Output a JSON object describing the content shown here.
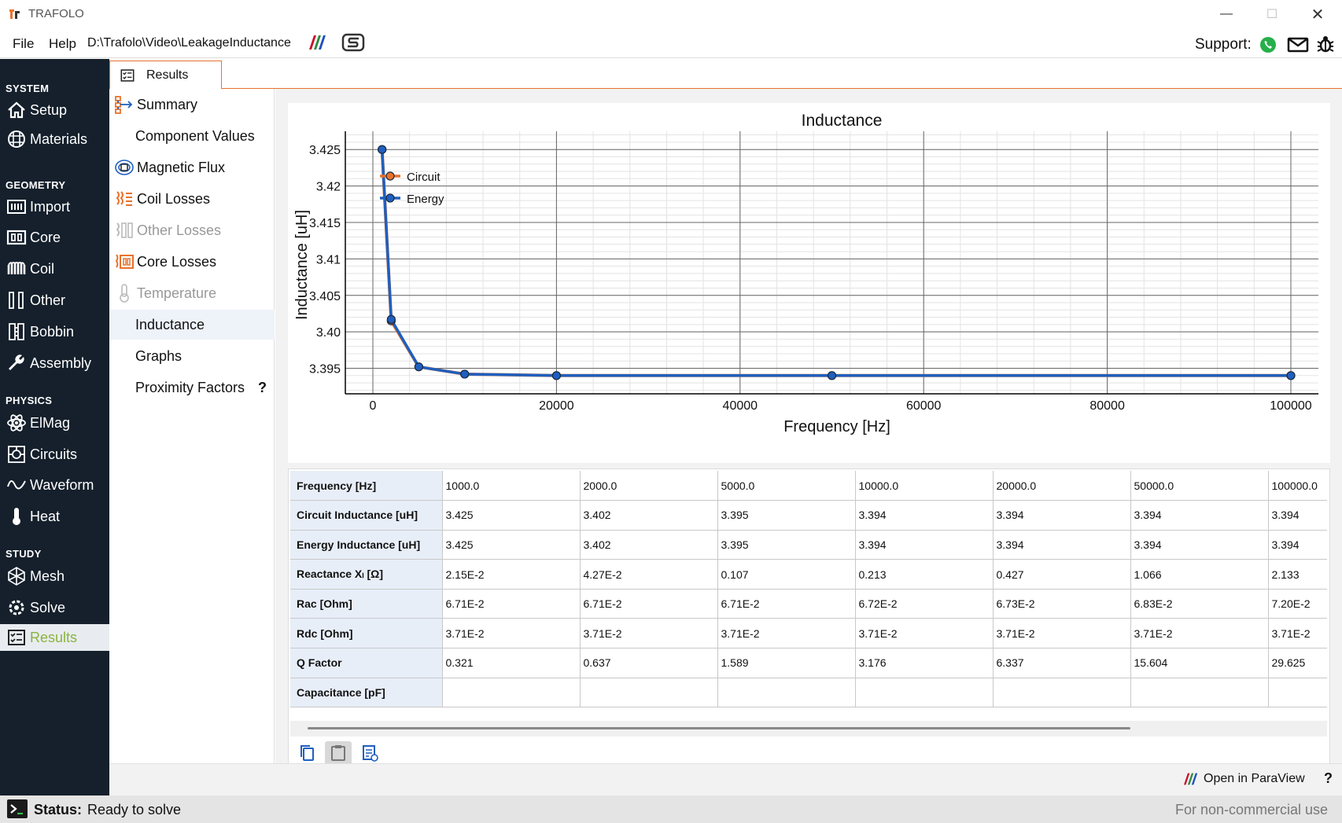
{
  "app": {
    "title": "TRAFOLO",
    "menu": [
      "File",
      "Help"
    ],
    "project_path": "D:\\Trafolo\\Video\\LeakageInductance",
    "support_label": "Support:"
  },
  "sidebar": {
    "sections": [
      {
        "label": "SYSTEM",
        "items": [
          {
            "label": "Setup",
            "icon": "home-icon"
          },
          {
            "label": "Materials",
            "icon": "materials-icon"
          }
        ]
      },
      {
        "label": "GEOMETRY",
        "items": [
          {
            "label": "Import",
            "icon": "import-icon"
          },
          {
            "label": "Core",
            "icon": "core-icon"
          },
          {
            "label": "Coil",
            "icon": "coil-icon"
          },
          {
            "label": "Other",
            "icon": "other-icon"
          },
          {
            "label": "Bobbin",
            "icon": "bobbin-icon"
          },
          {
            "label": "Assembly",
            "icon": "wrench-icon"
          }
        ]
      },
      {
        "label": "PHYSICS",
        "items": [
          {
            "label": "ElMag",
            "icon": "atom-icon"
          },
          {
            "label": "Circuits",
            "icon": "circuits-icon"
          },
          {
            "label": "Waveform",
            "icon": "waveform-icon"
          },
          {
            "label": "Heat",
            "icon": "thermometer-icon"
          }
        ]
      },
      {
        "label": "STUDY",
        "items": [
          {
            "label": "Mesh",
            "icon": "mesh-icon"
          },
          {
            "label": "Solve",
            "icon": "solve-icon"
          }
        ]
      }
    ],
    "active_item": {
      "label": "Results",
      "icon": "results-icon"
    },
    "active_color": "#8bb33f"
  },
  "tab": {
    "label": "Results"
  },
  "results_nav": [
    {
      "label": "Summary",
      "icon": "summary-icon"
    },
    {
      "label": "Component Values",
      "icon": ""
    },
    {
      "label": "Magnetic Flux",
      "icon": "flux-icon"
    },
    {
      "label": "Coil Losses",
      "icon": "coil-losses-icon"
    },
    {
      "label": "Other Losses",
      "icon": "other-losses-icon",
      "disabled": true
    },
    {
      "label": "Core Losses",
      "icon": "core-losses-icon"
    },
    {
      "label": "Temperature",
      "icon": "temperature-icon",
      "disabled": true
    },
    {
      "label": "Inductance",
      "icon": "",
      "selected": true
    },
    {
      "label": "Graphs",
      "icon": ""
    },
    {
      "label": "Proximity Factors",
      "icon": "",
      "help": "?"
    }
  ],
  "chart_data": {
    "type": "line",
    "title": "Inductance",
    "xlabel": "Frequency [Hz]",
    "ylabel": "Inductance [uH]",
    "xlim": [
      -3000,
      103000
    ],
    "ylim": [
      3.3915,
      3.4275
    ],
    "x_ticks": [
      0,
      20000,
      40000,
      60000,
      80000,
      100000
    ],
    "y_ticks": [
      3.395,
      3.4,
      3.405,
      3.41,
      3.415,
      3.42,
      3.425
    ],
    "y_tick_labels": [
      "3.395",
      "3.40",
      "3.405",
      "3.41",
      "3.415",
      "3.42",
      "3.425"
    ],
    "grid": true,
    "legend": "top-left",
    "x": [
      1000,
      2000,
      5000,
      10000,
      20000,
      50000,
      100000
    ],
    "series": [
      {
        "name": "Circuit",
        "values": [
          3.425,
          3.4015,
          3.3952,
          3.3942,
          3.394,
          3.394,
          3.394
        ],
        "color": "#e8722c"
      },
      {
        "name": "Energy",
        "values": [
          3.425,
          3.4017,
          3.3952,
          3.3942,
          3.394,
          3.394,
          3.394
        ],
        "color": "#1f5fbf"
      }
    ]
  },
  "table": {
    "rows": [
      {
        "label": "Frequency [Hz]",
        "values": [
          "1000.0",
          "2000.0",
          "5000.0",
          "10000.0",
          "20000.0",
          "50000.0",
          "100000.0"
        ]
      },
      {
        "label": "Circuit Inductance [uH]",
        "values": [
          "3.425",
          "3.402",
          "3.395",
          "3.394",
          "3.394",
          "3.394",
          "3.394"
        ]
      },
      {
        "label": "Energy Inductance [uH]",
        "values": [
          "3.425",
          "3.402",
          "3.395",
          "3.394",
          "3.394",
          "3.394",
          "3.394"
        ]
      },
      {
        "label": "Reactance Xₗ [Ω]",
        "values": [
          "2.15E-2",
          "4.27E-2",
          "0.107",
          "0.213",
          "0.427",
          "1.066",
          "2.133"
        ]
      },
      {
        "label": "Rac [Ohm]",
        "values": [
          "6.71E-2",
          "6.71E-2",
          "6.71E-2",
          "6.72E-2",
          "6.73E-2",
          "6.83E-2",
          "7.20E-2"
        ]
      },
      {
        "label": "Rdc [Ohm]",
        "values": [
          "3.71E-2",
          "3.71E-2",
          "3.71E-2",
          "3.71E-2",
          "3.71E-2",
          "3.71E-2",
          "3.71E-2"
        ]
      },
      {
        "label": "Q Factor",
        "values": [
          "0.321",
          "0.637",
          "1.589",
          "3.176",
          "6.337",
          "15.604",
          "29.625"
        ]
      },
      {
        "label": "Capacitance [pF]",
        "values": [
          "",
          "",
          "",
          "",
          "",
          "",
          ""
        ]
      }
    ]
  },
  "bottom": {
    "open_paraview": "Open in ParaView",
    "help": "?",
    "status_label": "Status:",
    "status_text": "Ready to solve",
    "license_text": "For non-commercial use"
  }
}
